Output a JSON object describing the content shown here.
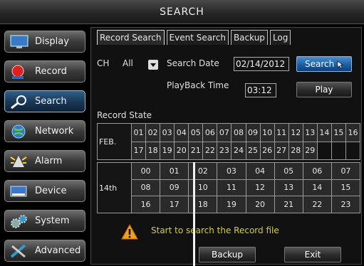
{
  "window": {
    "title": "SEARCH"
  },
  "sidebar": {
    "items": [
      {
        "label": "Display",
        "icon": "monitor-icon"
      },
      {
        "label": "Record",
        "icon": "record-icon"
      },
      {
        "label": "Search",
        "icon": "magnifier-icon",
        "active": true
      },
      {
        "label": "Network",
        "icon": "globe-icon"
      },
      {
        "label": "Alarm",
        "icon": "alarm-icon"
      },
      {
        "label": "Device",
        "icon": "hard-drive-icon"
      },
      {
        "label": "System",
        "icon": "gear-icon"
      },
      {
        "label": "Advanced",
        "icon": "tools-icon"
      }
    ]
  },
  "tabs": [
    {
      "label": "Record Search",
      "active": true
    },
    {
      "label": "Event Search"
    },
    {
      "label": "Backup"
    },
    {
      "label": "Log"
    }
  ],
  "form": {
    "ch_label": "CH",
    "ch_value": "All",
    "search_date_label": "Search Date",
    "search_date_value": "02/14/2012",
    "playback_time_label": "PlayBack Time",
    "playback_time_value": "03:12",
    "search_button": "Search",
    "play_button": "Play"
  },
  "record_state": {
    "label": "Record State",
    "month_label": "FEB.",
    "days_row1": [
      "01",
      "02",
      "03",
      "04",
      "05",
      "06",
      "07",
      "08",
      "09",
      "10",
      "11",
      "12",
      "13",
      "14",
      "15",
      "16"
    ],
    "days_row2": [
      "17",
      "18",
      "19",
      "20",
      "21",
      "22",
      "23",
      "24",
      "25",
      "26",
      "27",
      "28",
      "29",
      "",
      "",
      ""
    ],
    "day_label": "14th",
    "hours": [
      [
        "00",
        "01",
        "02",
        "03",
        "04",
        "05",
        "06",
        "07"
      ],
      [
        "08",
        "09",
        "10",
        "11",
        "12",
        "13",
        "14",
        "15"
      ],
      [
        "16",
        "17",
        "18",
        "19",
        "20",
        "21",
        "22",
        "23"
      ]
    ]
  },
  "status": {
    "message": "Start to search the Record file"
  },
  "footer": {
    "backup_button": "Backup",
    "exit_button": "Exit"
  },
  "colors": {
    "accent": "#1b5ea8",
    "warning_text": "#d8d020"
  }
}
